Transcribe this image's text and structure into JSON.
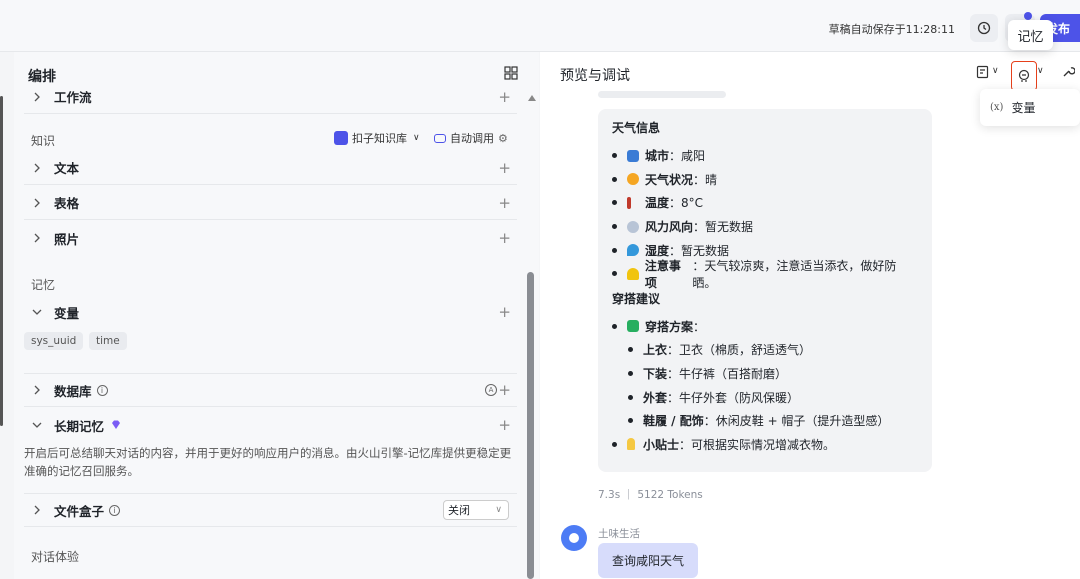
{
  "topbar": {
    "save_status": "草稿自动保存于11:28:11",
    "publish_label": "发布",
    "history_icon": "history-icon"
  },
  "tooltip": {
    "text": "记忆"
  },
  "left": {
    "title": "编排",
    "workflow_label": "工作流",
    "knowledge_section": "知识",
    "kb_link": "扣子知识库",
    "auto_call": "自动调用",
    "knowledge_items": [
      "文本",
      "表格",
      "照片"
    ],
    "memory_section": "记忆",
    "variable_label": "变量",
    "variable_tags": [
      "sys_uuid",
      "time"
    ],
    "database_label": "数据库",
    "long_memory_label": "长期记忆",
    "long_memory_desc": "开启后可总结聊天对话的内容，并用于更好的响应用户的消息。由火山引擎-记忆库提供更稳定更准确的记忆召回服务。",
    "file_box_label": "文件盒子",
    "file_box_value": "关闭",
    "dialog_section": "对话体验"
  },
  "right": {
    "title": "预览与调试",
    "dropdown_item": "变量",
    "dropdown_prefix": "(x)",
    "weather_header": "天气信息",
    "weather": [
      {
        "k": "城市",
        "v": "：咸阳",
        "color": "#3a7bd5"
      },
      {
        "k": "天气状况",
        "v": "：晴",
        "color": "#f5a623"
      },
      {
        "k": "温度",
        "v": "：8°C",
        "color": "#c0392b"
      },
      {
        "k": "风力风向",
        "v": "：暂无数据",
        "color": "#b8c4d6"
      },
      {
        "k": "湿度",
        "v": "：暂无数据",
        "color": "#3498db"
      },
      {
        "k": "注意事项",
        "v": "：天气较凉爽，注意适当添衣，做好防晒。",
        "color": "#f1c40f"
      }
    ],
    "outfit_header": "穿搭建议",
    "outfit_plan_label": "穿搭方案",
    "outfit_plan_suffix": "：",
    "outfit_items": [
      {
        "k": "上衣",
        "v": "：卫衣（棉质，舒适透气）"
      },
      {
        "k": "下装",
        "v": "：牛仔裤（百搭耐磨）"
      },
      {
        "k": "外套",
        "v": "：牛仔外套（防风保暖）"
      },
      {
        "k": "鞋履 / 配饰",
        "v": "：休闲皮鞋 + 帽子（提升造型感）"
      }
    ],
    "tip_label": "小贴士",
    "tip_text": "：可根据实际情况增减衣物。",
    "meta": "7.3s ｜ 5122 Tokens",
    "user_name": "土味生活",
    "user_message": "查询咸阳天气"
  }
}
